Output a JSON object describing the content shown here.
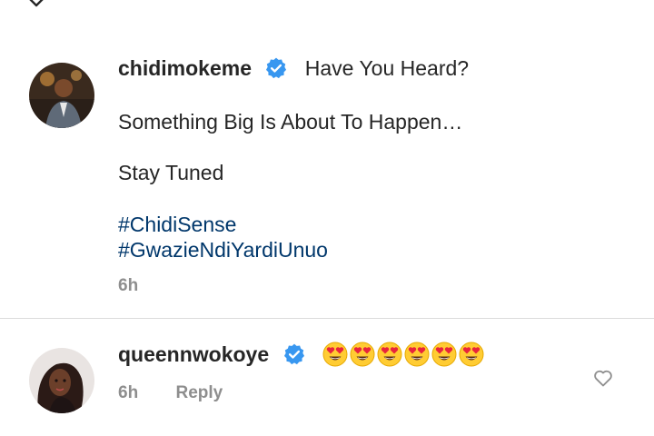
{
  "post": {
    "username": "chidimokeme",
    "verified": true,
    "caption_lines": [
      "Have You Heard?",
      "Something Big Is About To Happen…",
      "Stay Tuned"
    ],
    "hashtags": [
      "#ChidiSense",
      "#GwazieNdiYardiUnuo"
    ],
    "time": "6h"
  },
  "comment": {
    "username": "queennwokoye",
    "verified": true,
    "emoji": "heart-eyes",
    "emoji_count": 6,
    "time": "6h",
    "reply_label": "Reply"
  },
  "colors": {
    "verified_blue": "#3897f0",
    "hashtag": "#00376b",
    "meta_gray": "#8e8e8e",
    "text": "#262626",
    "divider": "#dbdbdb"
  }
}
